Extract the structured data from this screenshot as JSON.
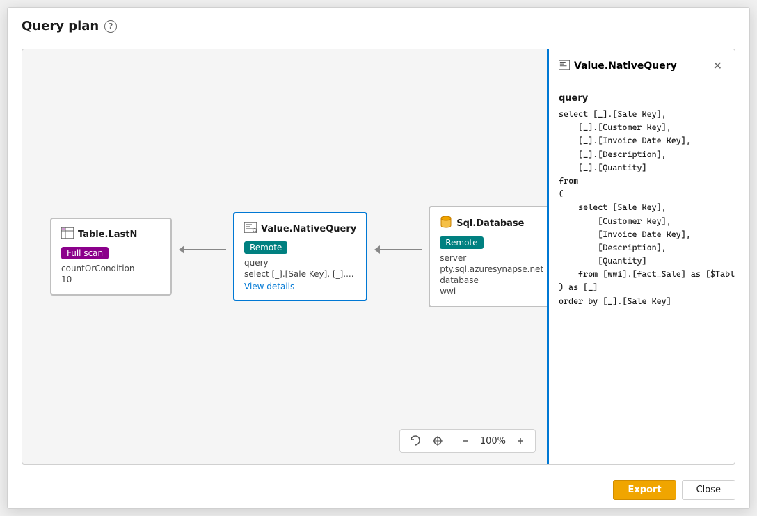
{
  "modal": {
    "title": "Query plan",
    "help_icon_label": "?",
    "export_label": "Export",
    "close_label": "Close"
  },
  "nodes": [
    {
      "id": "table-last-n",
      "title": "Table.LastN",
      "icon": "table-icon",
      "badge": "Full scan",
      "badge_type": "purple",
      "props": [
        {
          "key": "countOrCondition",
          "value": ""
        },
        {
          "key": "10",
          "value": ""
        }
      ]
    },
    {
      "id": "value-native-query",
      "title": "Value.NativeQuery",
      "icon": "query-icon",
      "badge": "Remote",
      "badge_type": "teal",
      "props": [
        {
          "key": "query",
          "value": ""
        },
        {
          "key": "select [_].[Sale Key], [_]....",
          "value": ""
        }
      ],
      "link": "View details"
    },
    {
      "id": "sql-database",
      "title": "Sql.Database",
      "icon": "database-icon",
      "badge": "Remote",
      "badge_type": "teal",
      "props": [
        {
          "key": "server",
          "value": ""
        },
        {
          "key": "pty.sql.azuresynapse.net",
          "value": ""
        },
        {
          "key": "database",
          "value": ""
        },
        {
          "key": "wwi",
          "value": ""
        }
      ]
    }
  ],
  "toolbar": {
    "zoom_level": "100%",
    "undo_icon": "undo-icon",
    "fit_icon": "fit-icon",
    "zoom_out_icon": "zoom-out-icon",
    "zoom_in_icon": "zoom-in-icon"
  },
  "detail_panel": {
    "title": "Value.NativeQuery",
    "icon": "query-icon",
    "section_label": "query",
    "query_text": "select [_].[Sale Key],\n    [_].[Customer Key],\n    [_].[Invoice Date Key],\n    [_].[Description],\n    [_].[Quantity]\nfrom\n(\n    select [Sale Key],\n        [Customer Key],\n        [Invoice Date Key],\n        [Description],\n        [Quantity]\n    from [wwi].[fact_Sale] as [$Table]\n) as [_]\norder by [_].[Sale Key]"
  }
}
